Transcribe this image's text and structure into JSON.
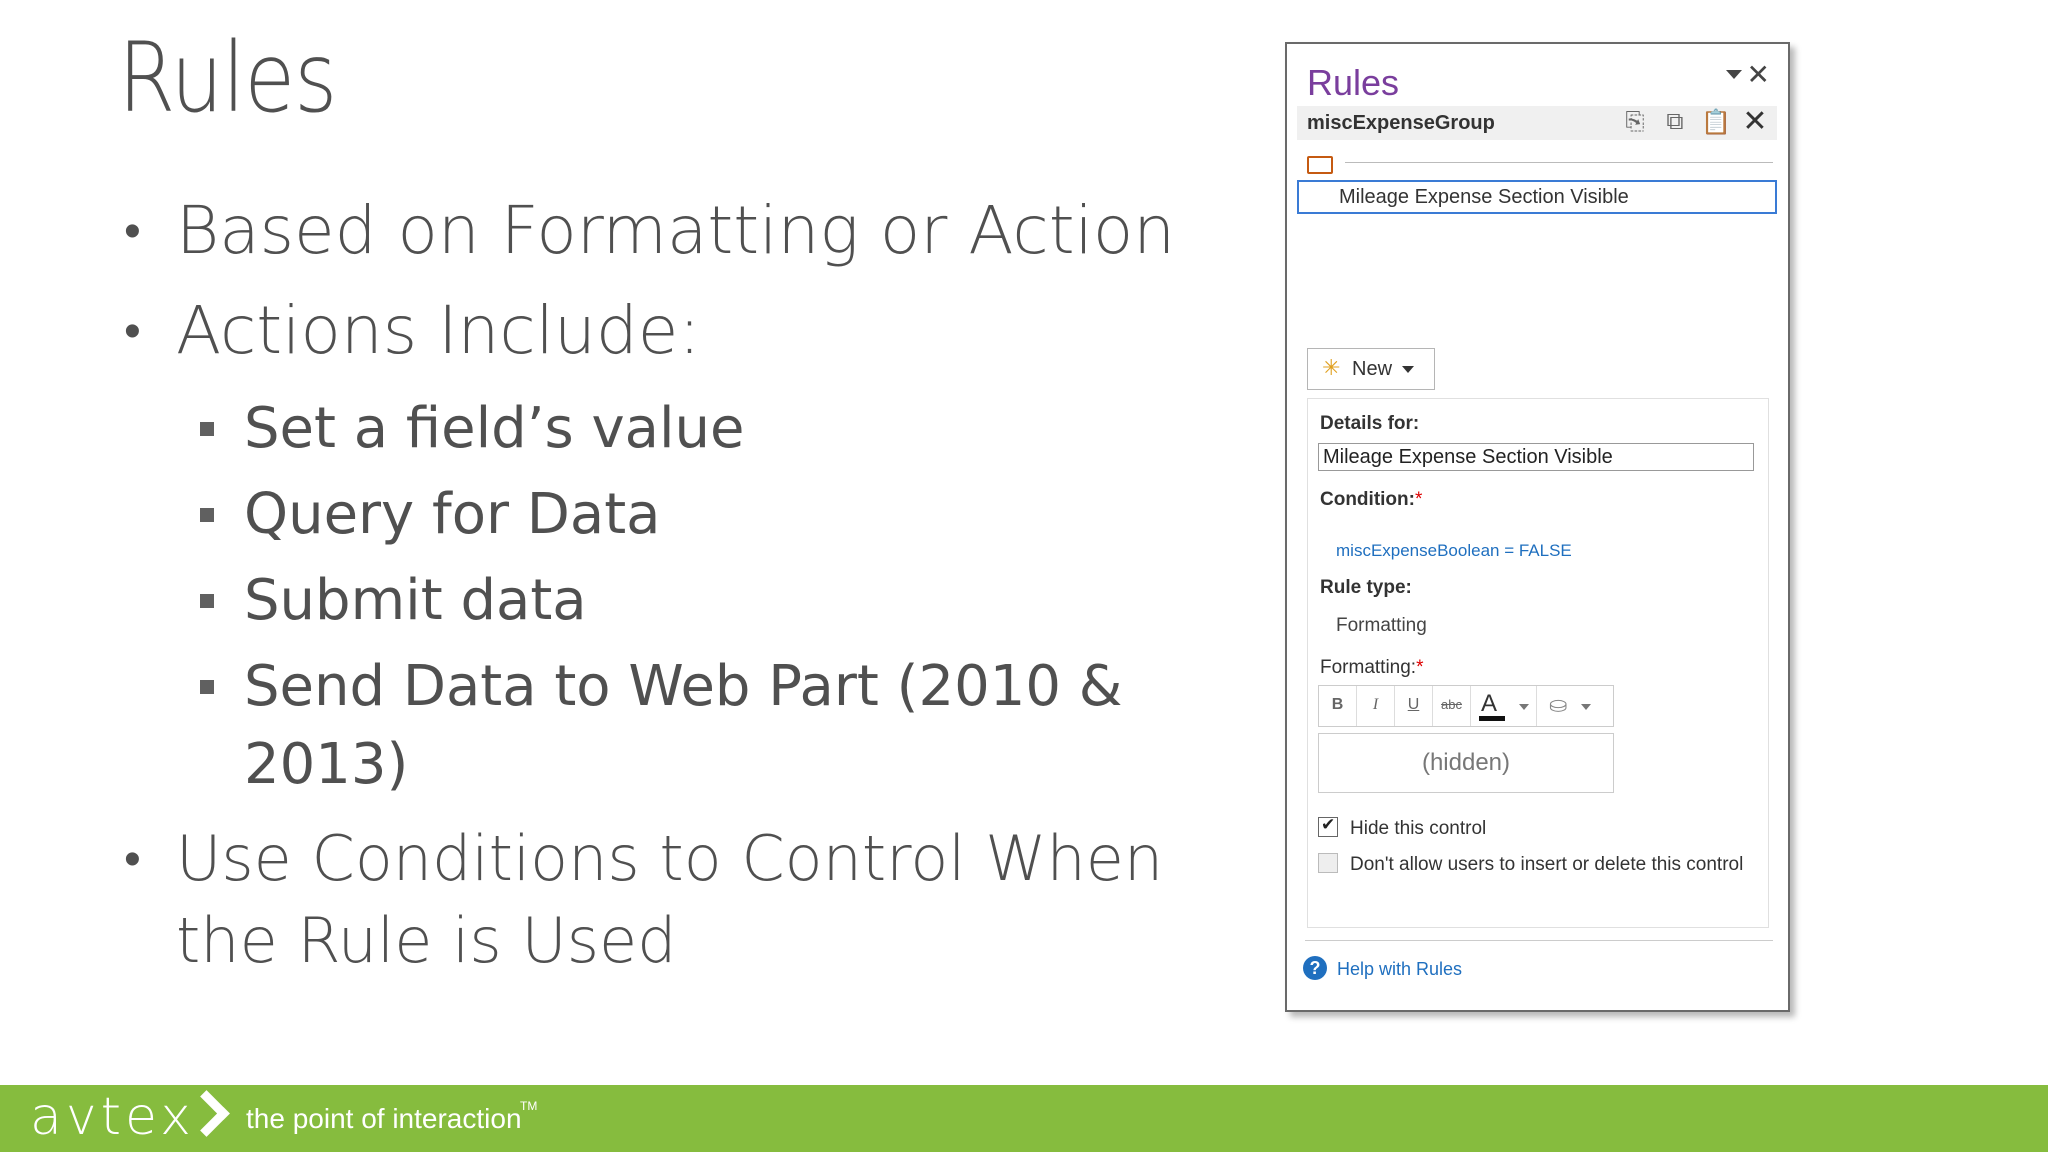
{
  "slide": {
    "title": "Rules",
    "bullets": {
      "b1": "Based on Formatting or Action",
      "b2": "Actions Include:",
      "sub": [
        "Set a field’s value",
        "Query for Data",
        "Submit data",
        "Send Data to Web Part (2010 & 2013)"
      ],
      "b3": "Use Conditions to Control When the Rule is Used"
    }
  },
  "pane": {
    "title": "Rules",
    "group": "miscExpenseGroup",
    "icons": [
      "copy-rule-icon",
      "copy-all-icon",
      "paste-icon",
      "delete-icon"
    ],
    "rule_item": "Mileage Expense Section Visible",
    "new_label": "New",
    "details_label": "Details for:",
    "details_value": "Mileage Expense Section Visible",
    "condition_label": "Condition:",
    "required_mark": "*",
    "condition_value": "miscExpenseBoolean = FALSE",
    "rule_type_label": "Rule type:",
    "rule_type_value": "Formatting",
    "formatting_label": "Formatting:",
    "fmt_buttons": [
      "B",
      "I",
      "U",
      "abc"
    ],
    "fmt_color_letter": "A",
    "preview": "(hidden)",
    "hide_label": "Hide this control",
    "hide_checked": true,
    "dont_allow_label": "Don't allow users to insert or delete this control",
    "help": "Help with Rules"
  },
  "footer": {
    "logo": "avtex",
    "tagline": "the point of interaction",
    "tm": "TM",
    "color": "#86bc3e"
  }
}
